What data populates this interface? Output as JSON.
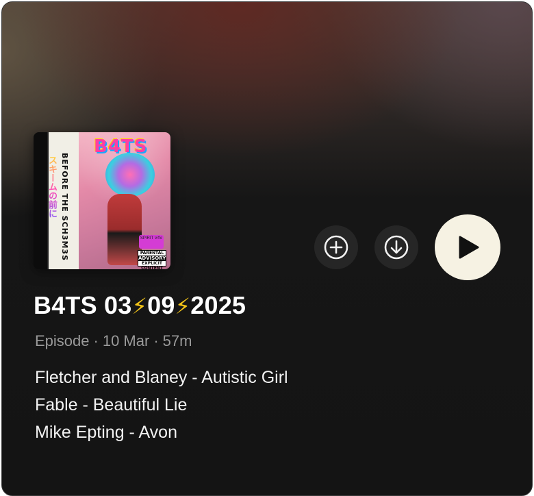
{
  "episode": {
    "title_parts": [
      "B4TS 03",
      "⚡",
      "09",
      "⚡",
      "2025"
    ],
    "type": "Episode",
    "date": "10 Mar",
    "duration": "57m",
    "separator": "·"
  },
  "tracks": [
    "Fletcher and Blaney - Autistic Girl",
    "Fable - Beautiful Lie",
    "Mike Epting - Avon"
  ],
  "cover": {
    "art_title": "B4TS",
    "spine_text": "BEFORE THE SCH3M3S",
    "spine_jp": "スキームの前に",
    "advisory_top": "PARENTAL",
    "advisory_main": "ADVISORY",
    "advisory_bottom": "EXPLICIT CONTENT",
    "sticker": "SPIRIT V4V"
  },
  "controls": {
    "add_icon": "add-circle-icon",
    "download_icon": "download-circle-icon",
    "play_icon": "play-icon"
  },
  "colors": {
    "play_button_bg": "#f6f2e3",
    "secondary_button_bg": "#262626",
    "card_bg": "#141414",
    "meta_text": "#9a9a9a",
    "bolt": "#f5c518"
  }
}
